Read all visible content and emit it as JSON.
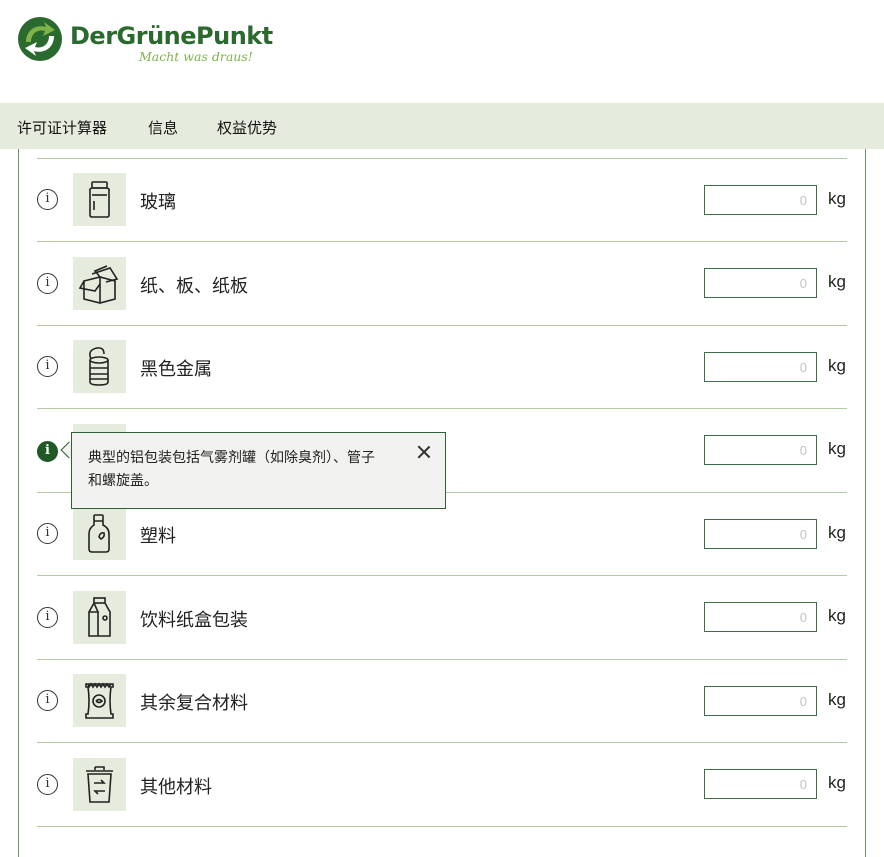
{
  "brand": {
    "name": "DerGrünePunkt",
    "tagline": "Macht was draus!",
    "colors": {
      "dark_green": "#2a6a2f",
      "light_green": "#7fb24a",
      "nav_bg": "#e6ecdd"
    }
  },
  "nav": {
    "items": [
      {
        "label": "许可证计算器"
      },
      {
        "label": "信息"
      },
      {
        "label": "权益优势"
      }
    ]
  },
  "materials": [
    {
      "label": "玻璃",
      "icon": "glass-jar-icon",
      "placeholder": "0",
      "unit": "kg"
    },
    {
      "label": "纸、板、纸板",
      "icon": "cardboard-box-icon",
      "placeholder": "0",
      "unit": "kg"
    },
    {
      "label": "黑色金属",
      "icon": "tin-can-icon",
      "placeholder": "0",
      "unit": "kg"
    },
    {
      "label": "",
      "icon": "aluminium-icon",
      "placeholder": "0",
      "unit": "kg"
    },
    {
      "label": "塑料",
      "icon": "plastic-bottle-icon",
      "placeholder": "0",
      "unit": "kg"
    },
    {
      "label": "饮料纸盒包装",
      "icon": "beverage-carton-icon",
      "placeholder": "0",
      "unit": "kg"
    },
    {
      "label": "其余复合材料",
      "icon": "composite-bag-icon",
      "placeholder": "0",
      "unit": "kg"
    },
    {
      "label": "其他材料",
      "icon": "recycle-bin-icon",
      "placeholder": "0",
      "unit": "kg"
    }
  ],
  "tooltip": {
    "line1": "典型的铝包装包括气雾剂罐（如除臭剂）、管子",
    "line2": "和螺旋盖。"
  }
}
